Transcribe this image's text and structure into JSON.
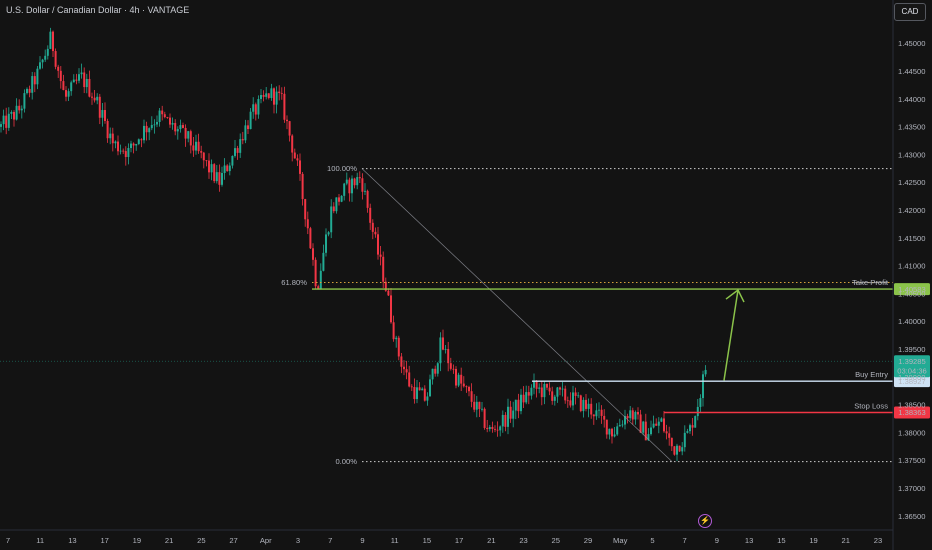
{
  "header": {
    "title": "U.S. Dollar / Canadian Dollar · 4h · VANTAGE",
    "currency": "CAD"
  },
  "chart_data": {
    "type": "candlestick",
    "ylim": [
      1.3625,
      1.4535
    ],
    "y_ticks": [
      "1.45000",
      "1.44500",
      "1.44000",
      "1.43500",
      "1.43000",
      "1.42500",
      "1.42000",
      "1.41500",
      "1.41000",
      "1.40500",
      "1.40000",
      "1.39500",
      "1.39000",
      "1.38500",
      "1.38000",
      "1.37500",
      "1.37000",
      "1.36500"
    ],
    "x_labels": [
      "7",
      "11",
      "13",
      "17",
      "19",
      "21",
      "25",
      "27",
      "Apr",
      "3",
      "7",
      "9",
      "11",
      "15",
      "17",
      "21",
      "23",
      "25",
      "29",
      "May",
      "5",
      "7",
      "9",
      "13",
      "15",
      "19",
      "21",
      "23"
    ],
    "colors": {
      "up": "#22ab94",
      "down": "#f23645"
    },
    "fibonacci": {
      "levels": [
        {
          "label": "100.00%",
          "price": 1.4275
        },
        {
          "label": "61.80%",
          "price": 1.407
        },
        {
          "label": "0.00%",
          "price": 1.3748
        }
      ],
      "color": "#cfcfcf"
    },
    "levels": [
      {
        "name": "Take Profit",
        "price": 1.40583,
        "price_label": "1.40583",
        "color": "#8bc34a"
      },
      {
        "name": "Buy Entry",
        "price": 1.38927,
        "price_label": "1.38927",
        "color": "#cfe3f5"
      },
      {
        "name": "Stop Loss",
        "price": 1.38363,
        "price_label": "1.38363",
        "color": "#f23645"
      }
    ],
    "current_price": {
      "price": 1.39285,
      "label": "1.39285",
      "countdown": "03:04:36",
      "color": "#22ab94"
    },
    "arrow_color": "#8bc34a",
    "path": [
      {
        "t": 0,
        "p": 1.435
      },
      {
        "t": 18,
        "p": 1.438
      },
      {
        "t": 38,
        "p": 1.445
      },
      {
        "t": 50,
        "p": 1.451
      },
      {
        "t": 64,
        "p": 1.44
      },
      {
        "t": 80,
        "p": 1.444
      },
      {
        "t": 95,
        "p": 1.44
      },
      {
        "t": 112,
        "p": 1.432
      },
      {
        "t": 128,
        "p": 1.4305
      },
      {
        "t": 143,
        "p": 1.4345
      },
      {
        "t": 158,
        "p": 1.437
      },
      {
        "t": 172,
        "p": 1.435
      },
      {
        "t": 186,
        "p": 1.433
      },
      {
        "t": 202,
        "p": 1.429
      },
      {
        "t": 218,
        "p": 1.425
      },
      {
        "t": 232,
        "p": 1.43
      },
      {
        "t": 250,
        "p": 1.437
      },
      {
        "t": 268,
        "p": 1.441
      },
      {
        "t": 280,
        "p": 1.44
      },
      {
        "t": 296,
        "p": 1.428
      },
      {
        "t": 306,
        "p": 1.418
      },
      {
        "t": 316,
        "p": 1.406
      },
      {
        "t": 330,
        "p": 1.42
      },
      {
        "t": 345,
        "p": 1.424
      },
      {
        "t": 360,
        "p": 1.426
      },
      {
        "t": 372,
        "p": 1.416
      },
      {
        "t": 384,
        "p": 1.407
      },
      {
        "t": 396,
        "p": 1.395
      },
      {
        "t": 410,
        "p": 1.388
      },
      {
        "t": 425,
        "p": 1.386
      },
      {
        "t": 440,
        "p": 1.396
      },
      {
        "t": 455,
        "p": 1.39
      },
      {
        "t": 470,
        "p": 1.386
      },
      {
        "t": 490,
        "p": 1.38
      },
      {
        "t": 512,
        "p": 1.384
      },
      {
        "t": 532,
        "p": 1.388
      },
      {
        "t": 552,
        "p": 1.387
      },
      {
        "t": 572,
        "p": 1.386
      },
      {
        "t": 592,
        "p": 1.384
      },
      {
        "t": 612,
        "p": 1.38
      },
      {
        "t": 628,
        "p": 1.384
      },
      {
        "t": 645,
        "p": 1.38
      },
      {
        "t": 660,
        "p": 1.382
      },
      {
        "t": 672,
        "p": 1.377
      },
      {
        "t": 688,
        "p": 1.38
      },
      {
        "t": 698,
        "p": 1.386
      },
      {
        "t": 706,
        "p": 1.3928
      }
    ]
  }
}
